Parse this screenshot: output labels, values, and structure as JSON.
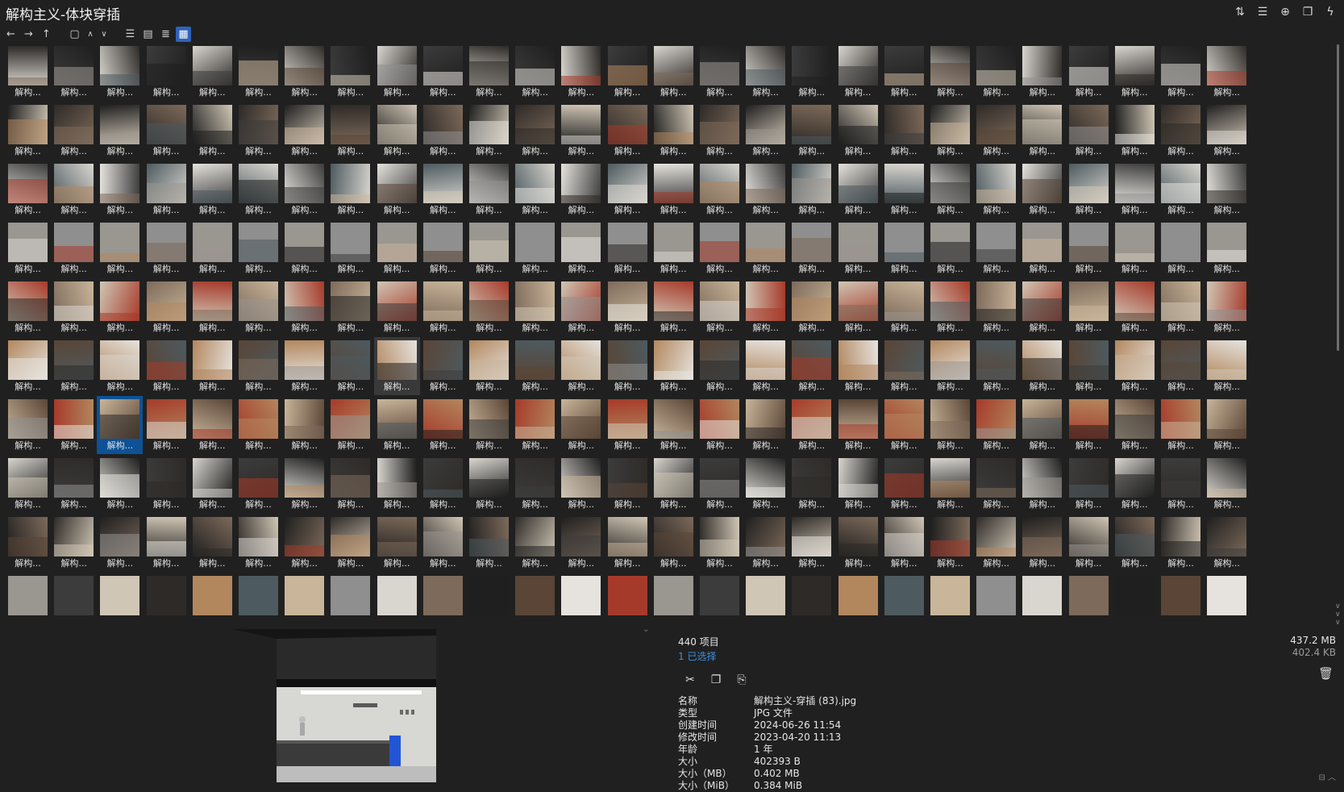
{
  "window": {
    "title": "解构主义-体块穿插"
  },
  "top_right_icons": [
    "sort-icon",
    "details-list-icon",
    "add-circle-icon",
    "clipboard-icon",
    "flash-icon"
  ],
  "toolbar": {
    "nav": [
      "back-arrow-icon",
      "forward-arrow-icon",
      "up-arrow-icon"
    ],
    "extra": [
      "open-window-icon",
      "chevron-up-icon",
      "chevron-down-icon"
    ],
    "views": [
      "view-list-icon",
      "view-details-icon",
      "view-tree-icon",
      "view-grid-icon"
    ],
    "active_view": "view-grid-icon"
  },
  "gallery": {
    "item_label": "解构...",
    "columns": 27,
    "visible_rows": 9,
    "selected_index": 164,
    "hover_index": 143
  },
  "status": {
    "item_count": "440 项目",
    "selected_count": "1 已选择",
    "total_size": "437.2 MB",
    "selected_size": "402.4 KB"
  },
  "actions": [
    "cut-icon",
    "copy-icon",
    "rename-icon"
  ],
  "properties": [
    {
      "key": "名称",
      "value": "解构主义-穿插 (83).jpg"
    },
    {
      "key": "类型",
      "value": "JPG 文件"
    },
    {
      "key": "创建时间",
      "value": "2024-06-26  11:54"
    },
    {
      "key": "修改时间",
      "value": "2023-04-20  11:13"
    },
    {
      "key": "年龄",
      "value": "1 年"
    },
    {
      "key": "大小",
      "value": "402393 B"
    },
    {
      "key": "大小（MB）",
      "value": "0.402 MB"
    },
    {
      "key": "大小（MiB）",
      "value": "0.384 MiB"
    }
  ],
  "colors": {
    "background": "#202020",
    "selection": "#0d5296",
    "accent_text": "#3d8fe8"
  }
}
